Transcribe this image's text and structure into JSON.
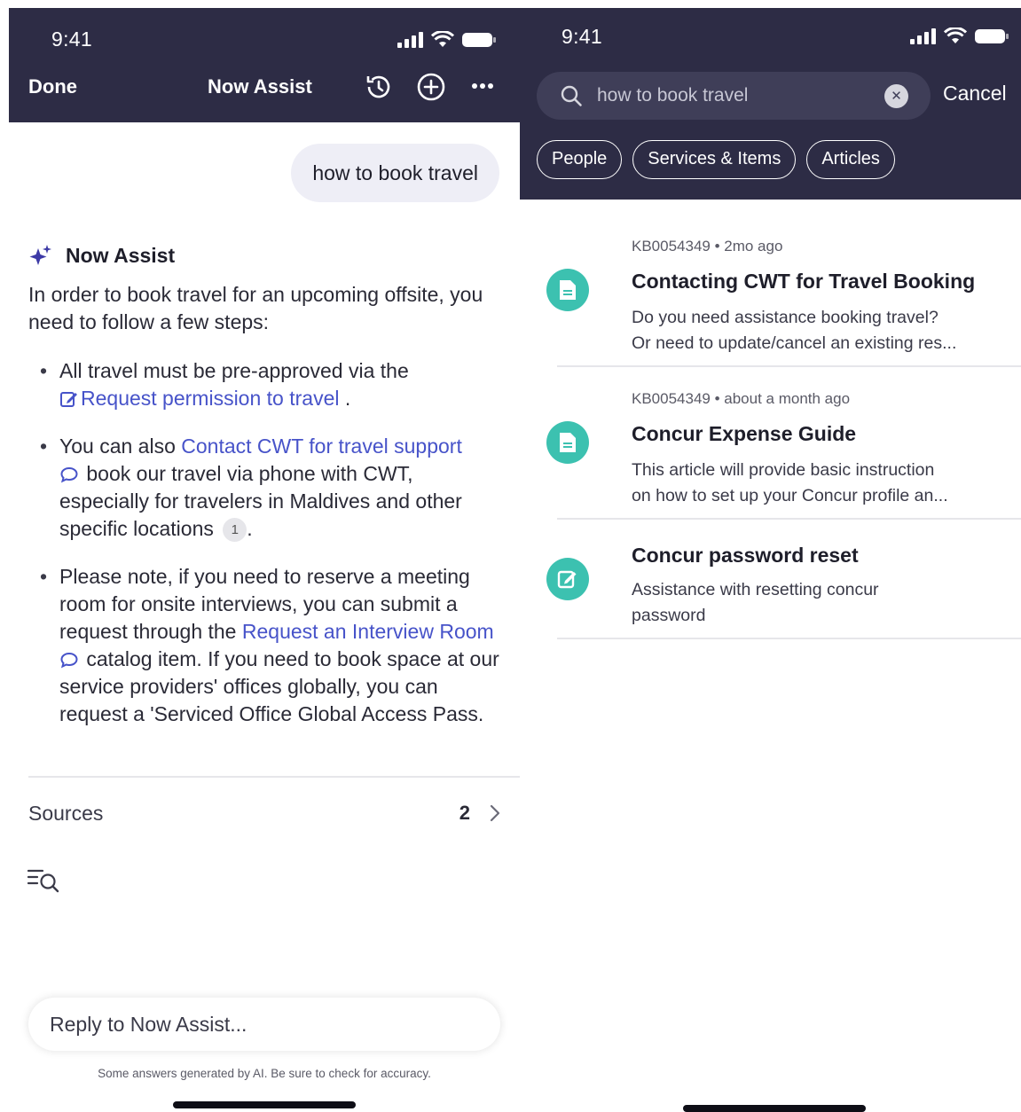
{
  "left_screen": {
    "status": {
      "time": "9:41"
    },
    "header": {
      "done_label": "Done",
      "title": "Now Assist"
    },
    "user_message": "how to book travel",
    "assistant": {
      "name": "Now Assist",
      "intro": "In order to book travel for an upcoming offsite, you need to follow a few steps:",
      "bullet1": {
        "text": "All travel must be pre-approved via the",
        "link": "Request permission to travel",
        "end": "."
      },
      "bullet2": {
        "pre": "You can also",
        "link": "Contact CWT for travel support",
        "post": "book our travel via phone with CWT, especially for travelers in Maldives and other specific locations",
        "citation": "1",
        "end": "."
      },
      "bullet3": {
        "pre": "Please note, if you need to reserve a meeting room for onsite interviews, you can submit a request through the",
        "link": "Request an Interview Room",
        "post": "catalog item. If you need to book space at our service providers' offices globally, you can request a 'Serviced Office Global Access Pass."
      }
    },
    "sources": {
      "label": "Sources",
      "count": "2"
    },
    "reply": {
      "placeholder": "Reply to Now Assist..."
    },
    "disclaimer": "Some answers generated by AI. Be sure to check for accuracy."
  },
  "right_screen": {
    "status": {
      "time": "9:41"
    },
    "search": {
      "query": "how to book travel",
      "cancel_label": "Cancel"
    },
    "filters": [
      "People",
      "Services & Items",
      "Articles"
    ],
    "results": [
      {
        "meta": "KB0054349 • 2mo ago",
        "title": "Contacting CWT for Travel Booking",
        "desc1": "Do you need assistance booking travel?",
        "desc2": "Or need to update/cancel an existing res...",
        "icon": "document-icon"
      },
      {
        "meta": "KB0054349 • about a month ago",
        "title": "Concur Expense Guide",
        "desc1": "This article will provide basic instruction",
        "desc2": "on how to set up your Concur profile an...",
        "icon": "document-icon"
      },
      {
        "meta": "",
        "title": "Concur password reset",
        "desc1": "Assistance with resetting concur",
        "desc2": "password",
        "icon": "edit-icon"
      }
    ]
  },
  "colors": {
    "header_bg": "#2d2c45",
    "link": "#4753c9",
    "accent_teal": "#3cc1b0",
    "bubble_bg": "#eeeef6"
  }
}
